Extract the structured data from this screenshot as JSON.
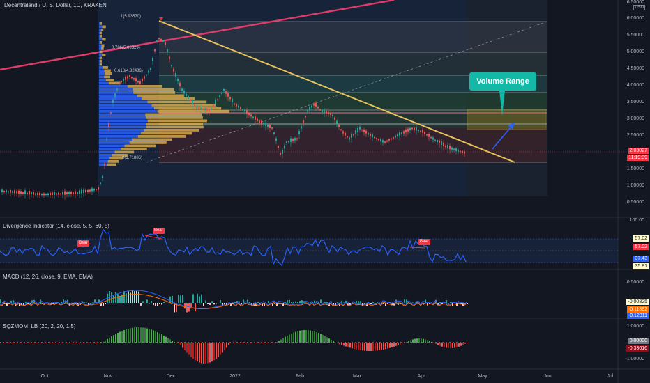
{
  "chart": {
    "symbol_title": "Decentraland / U. S. Dollar, 1D, KRAKEN",
    "currency": "USD",
    "top_tick": "6.50000",
    "price_ticks": [
      "6.00000",
      "5.50000",
      "5.00000",
      "4.50000",
      "4.00000",
      "3.50000",
      "3.00000",
      "2.50000",
      "2.00000",
      "1.50000",
      "1.00000",
      "0.50000"
    ],
    "last_price": "2.03027",
    "countdown": "11:19:39",
    "price_tag_color": "#f23645",
    "annotation_text": "Volume Range",
    "annotation_color": "#14b8a6",
    "fib_levels": [
      "1(5.93570)",
      "0.786(5.03329)",
      "0.618(4.32486)",
      "0.5(3.82)",
      "0.382(3.32)",
      "0(1.71886)"
    ]
  },
  "indicators": {
    "divergence": {
      "title": "Divergence Indicator (14, close, 5, 5, 60, 5)",
      "top_tick": "100.00",
      "values": [
        "57.02",
        "57.02",
        "37.43",
        "35.81"
      ],
      "bear_label": "Bear"
    },
    "macd": {
      "title": "MACD (12, 26, close, 9, EMA, EMA)",
      "tick": "0.50000",
      "values": [
        "-0.00825",
        "-0.11392",
        "-0.12311"
      ]
    },
    "sqzmom": {
      "title": "SQZMOM_LB (20, 2, 20, 1.5)",
      "ticks": [
        "1.00000",
        "-1.00000"
      ],
      "values": [
        "0.00000",
        "-0.33016"
      ]
    }
  },
  "time_axis": [
    "Oct",
    "Nov",
    "Dec",
    "2022",
    "Feb",
    "Mar",
    "Apr",
    "May",
    "Jun",
    "Jul"
  ]
}
